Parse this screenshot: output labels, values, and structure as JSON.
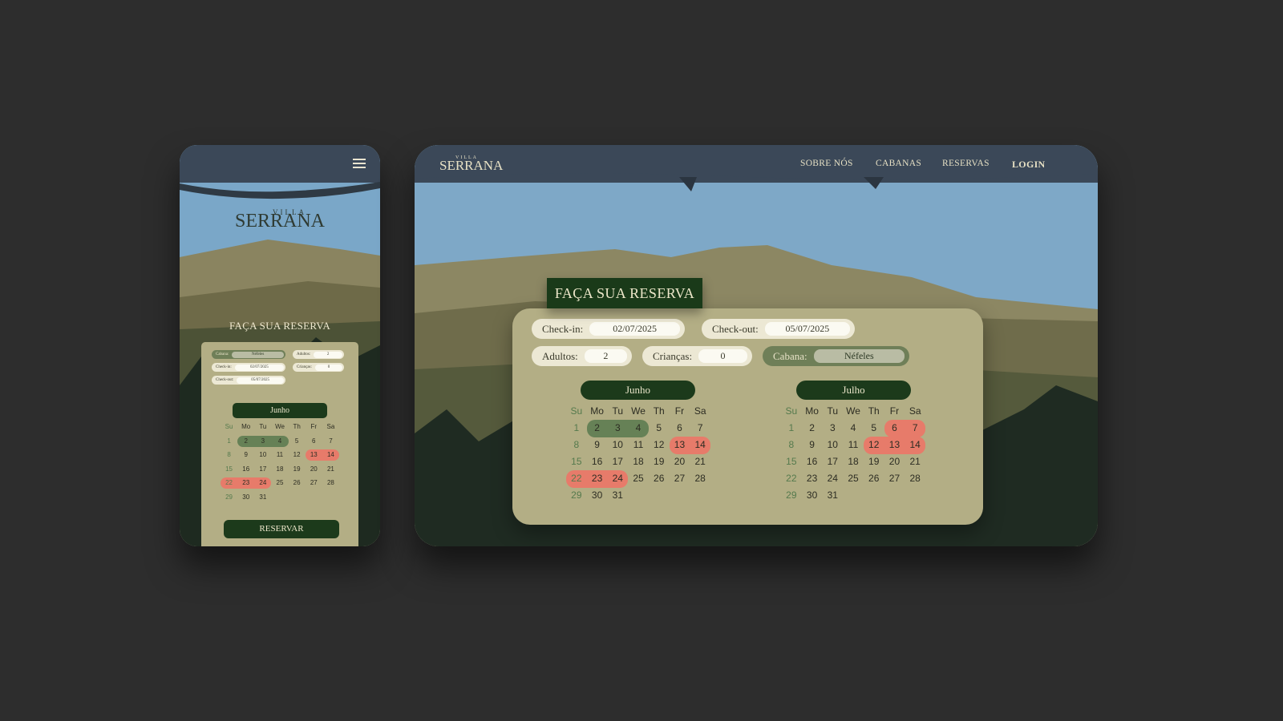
{
  "brand": {
    "top": "VILLA",
    "main": "SERRANA"
  },
  "nav": {
    "about": "SOBRE NÓS",
    "cabins": "CABANAS",
    "bookings": "RESERVAS",
    "login": "LOGIN"
  },
  "title": "FAÇA SUA RESERVA",
  "form": {
    "checkin_label": "Check-in:",
    "checkin_value": "02/07/2025",
    "checkout_label": "Check-out:",
    "checkout_value": "05/07/2025",
    "adults_label": "Adultos:",
    "adults_value": "2",
    "children_label": "Crianças:",
    "children_value": "0",
    "cabin_label": "Cabana:",
    "cabin_value": "Néfeles"
  },
  "weekdays": [
    "Su",
    "Mo",
    "Tu",
    "We",
    "Th",
    "Fr",
    "Sa"
  ],
  "months": [
    {
      "name": "Junho",
      "start": 0,
      "days": 31,
      "selected": [
        2,
        3,
        4
      ],
      "blocked": [
        13,
        14,
        22,
        23,
        24
      ]
    },
    {
      "name": "Julho",
      "start": 0,
      "days": 31,
      "selected": [],
      "blocked": [
        6,
        7,
        12,
        13,
        14
      ]
    }
  ],
  "reserve_button": "RESERVAR",
  "colors": {
    "dark_green": "#1c3a1b",
    "panel": "#b3ae85",
    "selected": "#668156",
    "blocked": "#e77b6a",
    "topbar": "#3b4858"
  }
}
